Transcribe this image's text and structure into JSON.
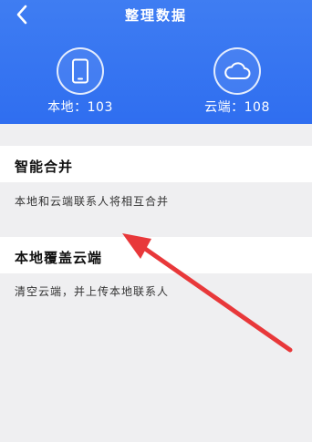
{
  "header": {
    "title": "整理数据",
    "back_icon": "chevron-left-icon",
    "background": "#3677f1",
    "local_label": "本地：103",
    "cloud_label": "云端：108",
    "local_icon": "phone-icon",
    "cloud_icon": "cloud-icon"
  },
  "options": [
    {
      "title": "智能合并",
      "description": "本地和云端联系人将相互合并"
    },
    {
      "title": "本地覆盖云端",
      "description": "清空云端，并上传本地联系人"
    }
  ],
  "annotation": {
    "arrow_color": "#e8383a"
  }
}
